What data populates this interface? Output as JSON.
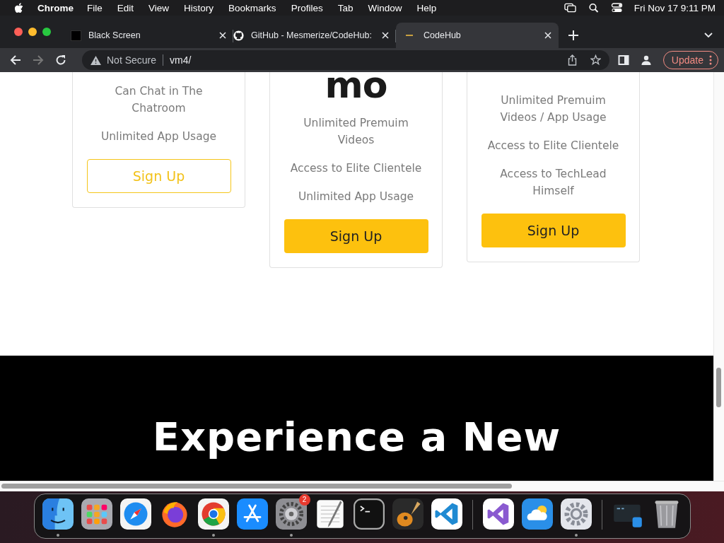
{
  "menubar": {
    "app": "Chrome",
    "menus": [
      "File",
      "Edit",
      "View",
      "History",
      "Bookmarks",
      "Profiles",
      "Tab",
      "Window",
      "Help"
    ],
    "clock": "Fri Nov 17  9:11 PM"
  },
  "tabs": [
    {
      "title": "Black Screen",
      "kind": "square",
      "selected": false
    },
    {
      "title": "GitHub - Mesmerize/CodeHub:",
      "kind": "github",
      "selected": false
    },
    {
      "title": "CodeHub",
      "kind": "dash",
      "selected": true
    }
  ],
  "toolbar": {
    "security": "Not Secure",
    "url": "vm4/",
    "update": "Update"
  },
  "cards": [
    {
      "features": [
        "Can Chat in The Chatroom",
        "Unlimited App Usage"
      ],
      "button": {
        "label": "Sign Up",
        "kind": "outline"
      }
    },
    {
      "heading": "mo",
      "features": [
        "Unlimited Premuim Videos",
        "Access to Elite Clientele",
        "Unlimited App Usage"
      ],
      "button": {
        "label": "Sign Up",
        "kind": "filled"
      }
    },
    {
      "features": [
        "Unlimited Premuim Videos / App Usage",
        "Access to Elite Clientele",
        "Access to TechLead Himself"
      ],
      "button": {
        "label": "Sign Up",
        "kind": "filled"
      }
    }
  ],
  "banner": {
    "heading": "Experience a New"
  },
  "dock": [
    {
      "kind": "finder",
      "running": true
    },
    {
      "kind": "launchpad",
      "running": false
    },
    {
      "kind": "safari",
      "running": false
    },
    {
      "kind": "firefox",
      "running": false
    },
    {
      "kind": "chrome",
      "running": true
    },
    {
      "kind": "appstore",
      "running": false
    },
    {
      "kind": "settings",
      "running": true,
      "badge": "2"
    },
    {
      "kind": "textedit",
      "running": false
    },
    {
      "kind": "terminal",
      "running": false
    },
    {
      "kind": "guitar",
      "running": false
    },
    {
      "kind": "vscode",
      "running": false
    },
    {
      "kind": "divider"
    },
    {
      "kind": "vstudio",
      "running": false
    },
    {
      "kind": "weather",
      "running": false
    },
    {
      "kind": "gear",
      "running": true
    },
    {
      "kind": "divider"
    },
    {
      "kind": "window",
      "running": false
    },
    {
      "kind": "trash",
      "running": false
    }
  ]
}
